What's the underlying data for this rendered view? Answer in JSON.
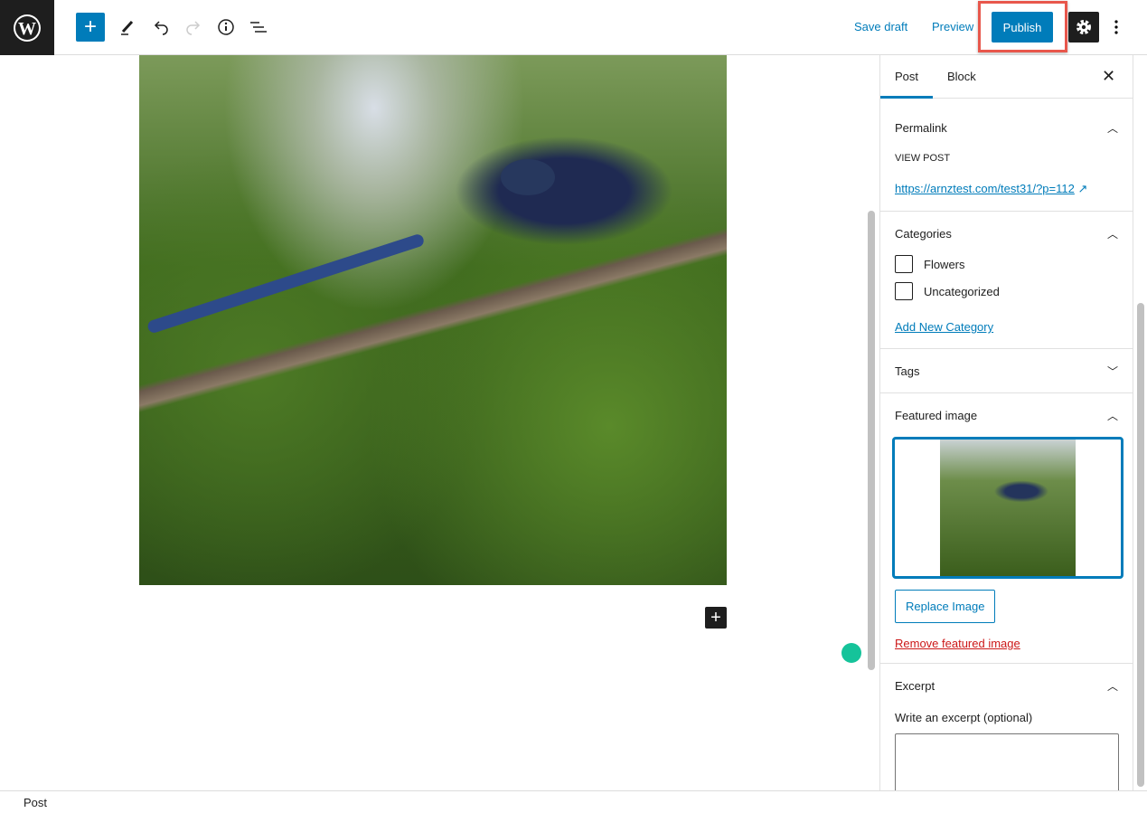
{
  "toolbar": {
    "save_draft": "Save draft",
    "preview": "Preview",
    "publish": "Publish"
  },
  "sidebar": {
    "tabs": [
      "Post",
      "Block"
    ],
    "permalink": {
      "title": "Permalink",
      "view_post": "VIEW POST",
      "url": "https://arnztest.com/test31/?p=112"
    },
    "categories": {
      "title": "Categories",
      "items": [
        "Flowers",
        "Uncategorized"
      ],
      "add_new": "Add New Category"
    },
    "tags": {
      "title": "Tags"
    },
    "featured": {
      "title": "Featured image",
      "replace": "Replace Image",
      "remove": "Remove featured image"
    },
    "excerpt": {
      "title": "Excerpt",
      "label": "Write an excerpt (optional)"
    }
  },
  "status": {
    "breadcrumb": "Post"
  },
  "colors": {
    "accent": "#007cba",
    "highlight": "#e8574c",
    "danger": "#cc1818"
  }
}
